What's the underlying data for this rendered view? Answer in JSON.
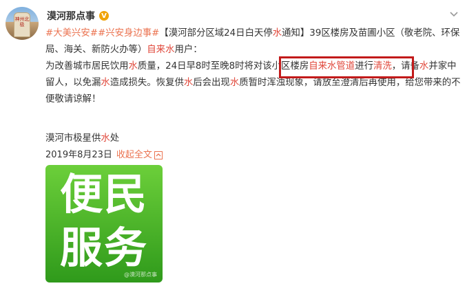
{
  "user": {
    "name": "漠河那点事",
    "verified_label": "V"
  },
  "post": {
    "segments": [
      {
        "text": "#大美兴安##兴安身边事#",
        "type": "link"
      },
      {
        "text": "【漠河部分区域24日白天停",
        "type": "text"
      },
      {
        "text": "水",
        "type": "hl"
      },
      {
        "text": "通知】39区楼房及苗圃小区（敬老院、环保局、海关、新防火办等）",
        "type": "text"
      },
      {
        "text": "自来水",
        "type": "hl"
      },
      {
        "text": "用户：",
        "type": "text"
      },
      {
        "text": "为改善城市居民饮用",
        "type": "text"
      },
      {
        "text": "水",
        "type": "hl"
      },
      {
        "text": "质量，24日早8时至晚8时将对该小区楼房",
        "type": "text"
      },
      {
        "text": "自来水管道",
        "type": "hl"
      },
      {
        "text": "进行",
        "type": "text"
      },
      {
        "text": "清洗",
        "type": "hl"
      },
      {
        "text": "，请备",
        "type": "text"
      },
      {
        "text": "水",
        "type": "hl"
      },
      {
        "text": "并家中留人，以免漏",
        "type": "text"
      },
      {
        "text": "水",
        "type": "hl"
      },
      {
        "text": "造成损失。恢复供",
        "type": "text"
      },
      {
        "text": "水",
        "type": "hl"
      },
      {
        "text": "后会出现",
        "type": "text"
      },
      {
        "text": "水",
        "type": "hl"
      },
      {
        "text": "质暂时浑浊现象，请放至澄清后再使用，给您带来的不便敬请谅解！",
        "type": "text"
      }
    ],
    "signature_prefix": "漠河市极星供",
    "signature_hl": "水",
    "signature_suffix": "处",
    "date": "2019年8月23日",
    "collapse_label": "收起全文"
  },
  "image": {
    "line1": "便民",
    "line2": "服务",
    "watermark": "@漠河那点事"
  },
  "avatar_text": "神州北极",
  "colors": {
    "link": "#eb7350",
    "highlight": "#e0473a",
    "box": "#c21a1a",
    "tile": "#3aa822"
  },
  "icons": [
    "verified-icon",
    "chevron-down-icon",
    "collapse-arrow-icon"
  ]
}
